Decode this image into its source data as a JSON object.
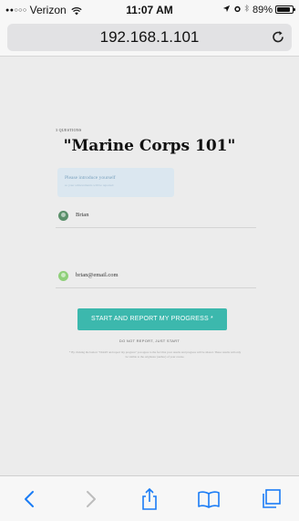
{
  "status_bar": {
    "signal": "●●○○○",
    "carrier": "Verizon",
    "time": "11:07 AM",
    "battery": "89%",
    "battery_level": 0.89,
    "icons": [
      "wifi-icon",
      "location-arrow-icon",
      "alarm-icon",
      "bluetooth-icon",
      "battery-icon"
    ]
  },
  "address_bar": {
    "url": "192.168.1.101",
    "reload_icon": "reload-icon"
  },
  "quiz": {
    "kicker": "3 QUESTIONS",
    "title": "\"Marine Corps 101\"",
    "intro_title": "Please introduce yourself",
    "intro_subtitle": "so your achievements will be reported",
    "name_value": "Brian",
    "email_value": "brian@email.com",
    "start_button": "START AND REPORT MY PROGRESS *",
    "no_report_link": "DO NOT REPORT, JUST START",
    "disclaimer": "* By clicking the button \"START and report my progress\" you agree to the fact that your results and progress will be shared. These results will only be visible to the originator (author) of your course."
  },
  "toolbar": {
    "icons": [
      "back-icon",
      "forward-icon",
      "share-icon",
      "bookmarks-icon",
      "tabs-icon"
    ]
  },
  "colors": {
    "accent": "#3cb8ad",
    "intro_box": "#dbe7f0",
    "ios_blue": "#1a7cf5"
  }
}
